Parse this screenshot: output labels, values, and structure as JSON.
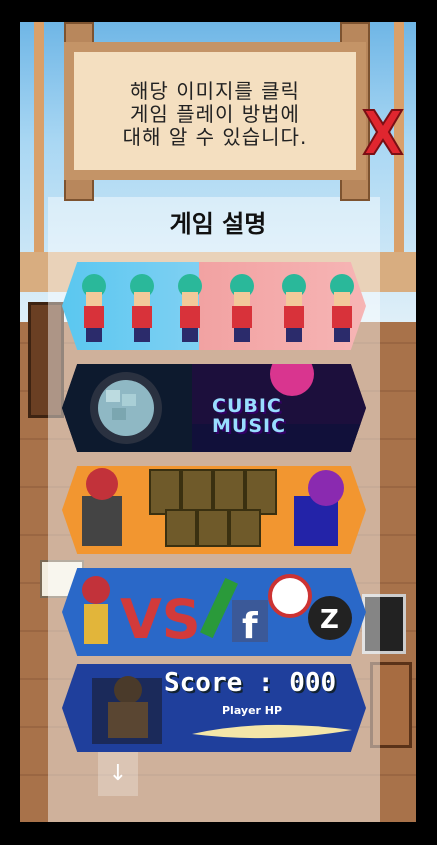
{
  "sign": {
    "lines": [
      "해당 이미지를 클릭",
      "게임 플레이 방법에",
      "대해 알 수 있습니다."
    ]
  },
  "title": "게임 설명",
  "cards": [
    {
      "name": "runner-game"
    },
    {
      "name": "cubic-music-game",
      "label_lines": [
        "CUBIC",
        "MUSIC"
      ]
    },
    {
      "name": "card-match-game"
    },
    {
      "name": "vs-social-game"
    },
    {
      "name": "score-battle-game",
      "score_label": "Score : 000",
      "hp_label": "Player HP"
    }
  ],
  "icons": {
    "close": "close-x-icon",
    "down": "arrow-down-icon"
  },
  "colors": {
    "close_red": "#e0262f",
    "sign_bg": "#f4dfc0",
    "sign_border": "#c49467"
  }
}
